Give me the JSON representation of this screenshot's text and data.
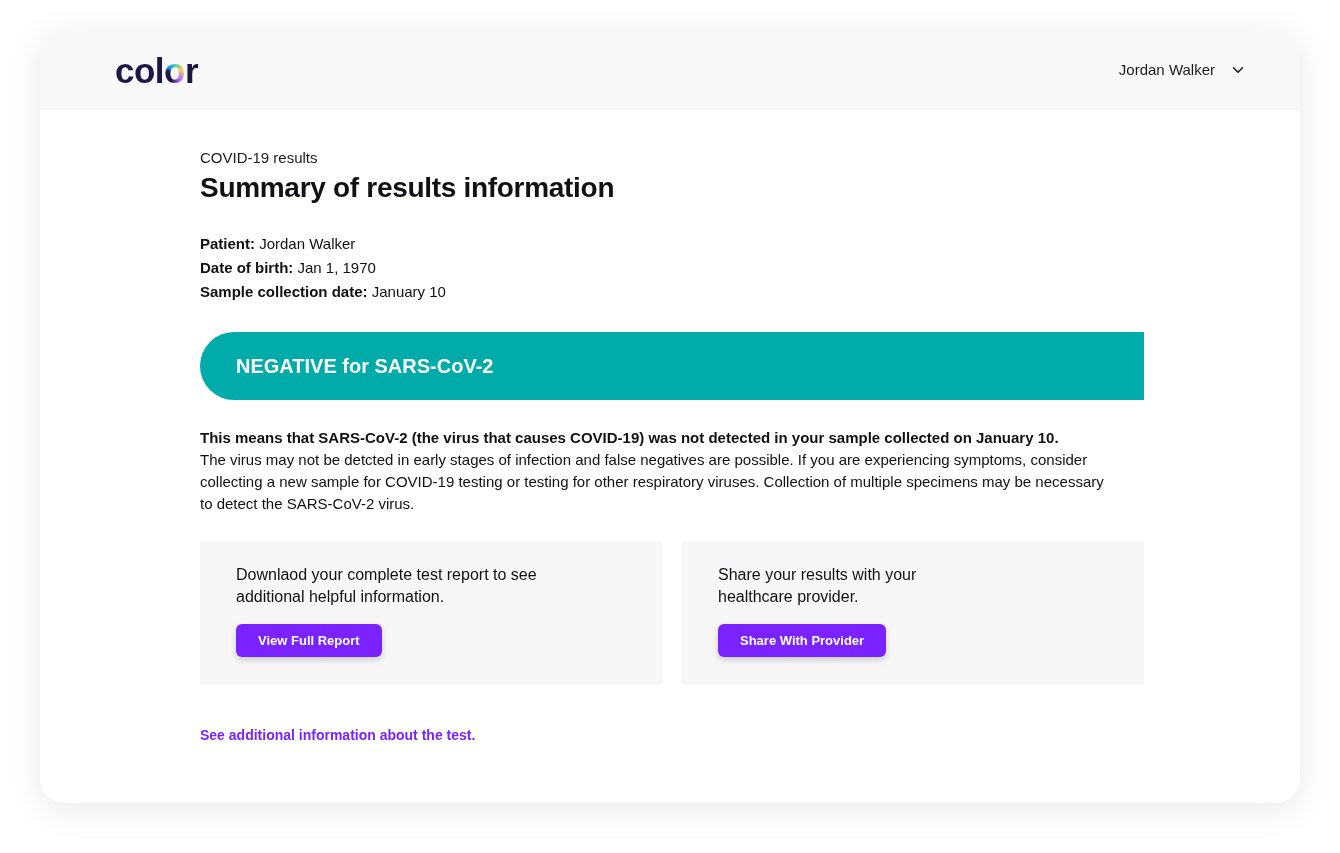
{
  "header": {
    "logo": "color",
    "user": {
      "name": "Jordan Walker"
    }
  },
  "page": {
    "eyebrow": "COVID-19 results",
    "title": "Summary of results information"
  },
  "patient_details": [
    "**Patient:** Jordan Walker",
    "**Date of birth:** Jan 1, 1970",
    "**Sample collection date:** January 10"
  ],
  "result_banner": {
    "text": "NEGATIVE for SARS-CoV-2"
  },
  "explanation": {
    "summary": "This means that SARS-CoV-2 (the virus that causes COVID-19) was not detected in your sample collected on January 10.",
    "details": "The virus may not be detcted in early stages of infection and false negatives are possible. If you are experiencing symptoms, consider collecting a new sample for COVID-19 testing or testing for other respiratory viruses. Collection of multiple specimens may be necessary to detect the SARS-CoV-2 virus."
  },
  "actions": [
    {
      "text": "Downlaod your complete test report to see\nadditional helpful information.",
      "button": "View Full Report"
    },
    {
      "text": "Share your results with your\nhealthcare provider.",
      "button": "Share With Provider"
    }
  ],
  "link": "See additional information about the test."
}
